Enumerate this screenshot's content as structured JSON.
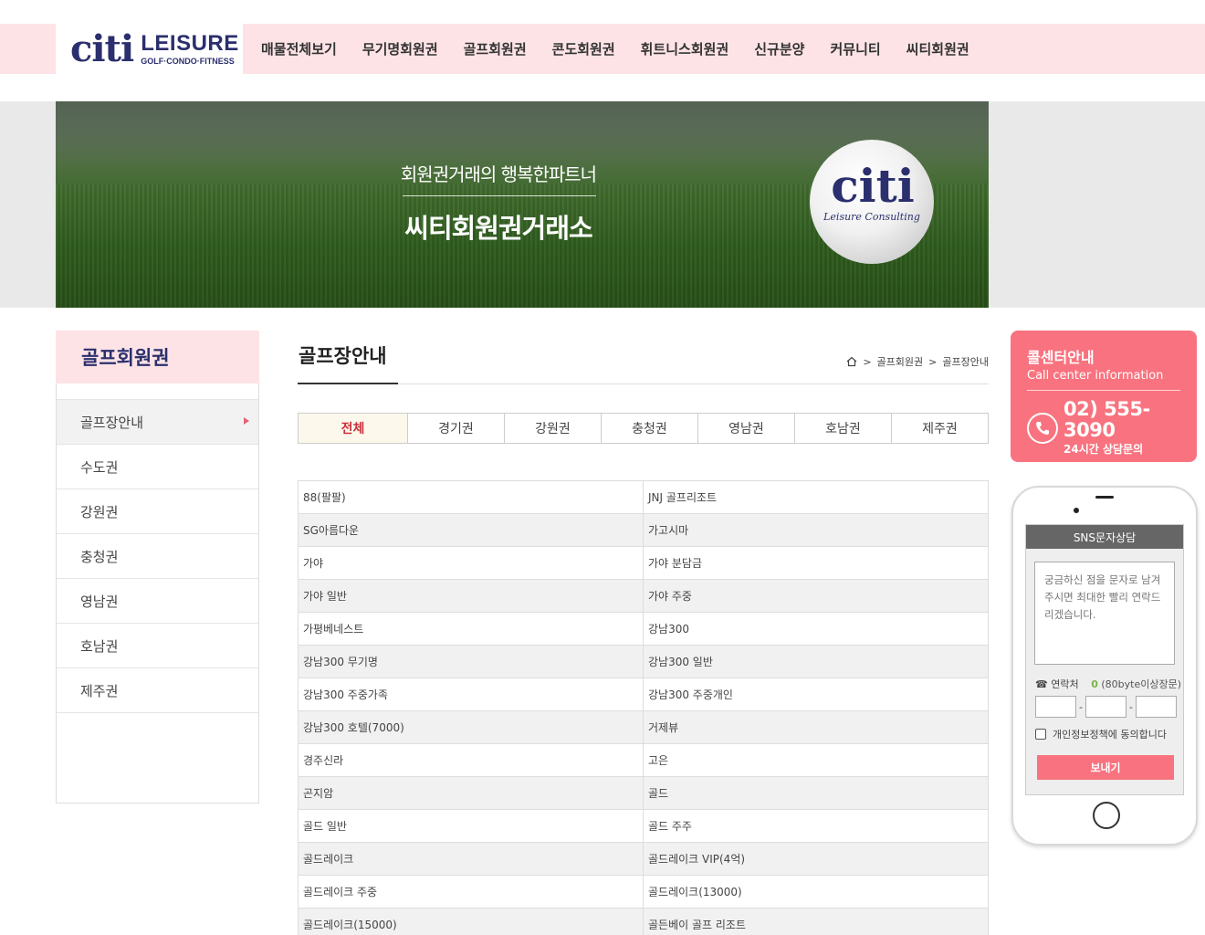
{
  "header": {
    "logo": {
      "brand": "citi",
      "name": "LEISURE",
      "sub": "GOLF·CONDO·FITNESS"
    },
    "nav": [
      "매물전체보기",
      "무기명회원권",
      "골프회원권",
      "콘도회원권",
      "휘트니스회원권",
      "신규분양",
      "커뮤니티",
      "씨티회원권"
    ]
  },
  "banner": {
    "subtitle": "회원권거래의 행복한파트너",
    "title": "씨티회원권거래소",
    "ball_brand": "citi",
    "ball_sub": "Leisure Consulting"
  },
  "sidebar": {
    "title": "골프회원권",
    "items": [
      {
        "label": "골프장안내",
        "active": true
      },
      {
        "label": "수도권"
      },
      {
        "label": "강원권"
      },
      {
        "label": "충청권"
      },
      {
        "label": "영남권"
      },
      {
        "label": "호남권"
      },
      {
        "label": "제주권"
      }
    ]
  },
  "content": {
    "title": "골프장안내",
    "breadcrumb": [
      "골프회원권",
      "골프장안내"
    ],
    "breadcrumb_sep": ">",
    "tabs": [
      "전체",
      "경기권",
      "강원권",
      "충청권",
      "영남권",
      "호남권",
      "제주권"
    ],
    "active_tab": "전체",
    "courses": [
      [
        "88(팔팔)",
        "JNJ 골프리조트"
      ],
      [
        "SG아름다운",
        "가고시마"
      ],
      [
        "가야",
        "가야 분담금"
      ],
      [
        "가야 일반",
        "가야 주중"
      ],
      [
        "가평베네스트",
        "강남300"
      ],
      [
        "강남300 무기명",
        "강남300 일반"
      ],
      [
        "강남300 주중가족",
        "강남300 주중개인"
      ],
      [
        "강남300 호텔(7000)",
        "거제뷰"
      ],
      [
        "경주신라",
        "고은"
      ],
      [
        "곤지암",
        "골드"
      ],
      [
        "골드 일반",
        "골드 주주"
      ],
      [
        "골드레이크",
        "골드레이크 VIP(4억)"
      ],
      [
        "골드레이크 주중",
        "골드레이크(13000)"
      ],
      [
        "골드레이크(15000)",
        "골든베이 골프 리조트"
      ]
    ]
  },
  "callcenter": {
    "title": "콜센터안내",
    "subtitle": "Call center information",
    "phone": "02) 555-3090",
    "hours": "24시간 상담문의"
  },
  "sms": {
    "header": "SNS문자상담",
    "placeholder": "궁금하신 점을 문자로 남겨주시면 최대한 빨리 연락드리겠습니다.",
    "contact_label": "☎ 연락처",
    "byte_count": "0",
    "byte_hint": "(80byte이상장문)",
    "dash": "-",
    "agree_label": "개인정보정책에 동의합니다",
    "send_label": "보내기"
  },
  "colors": {
    "accent": "#f8737f",
    "nav_bg": "#fde3e6",
    "brand_navy": "#2b2f6d"
  }
}
